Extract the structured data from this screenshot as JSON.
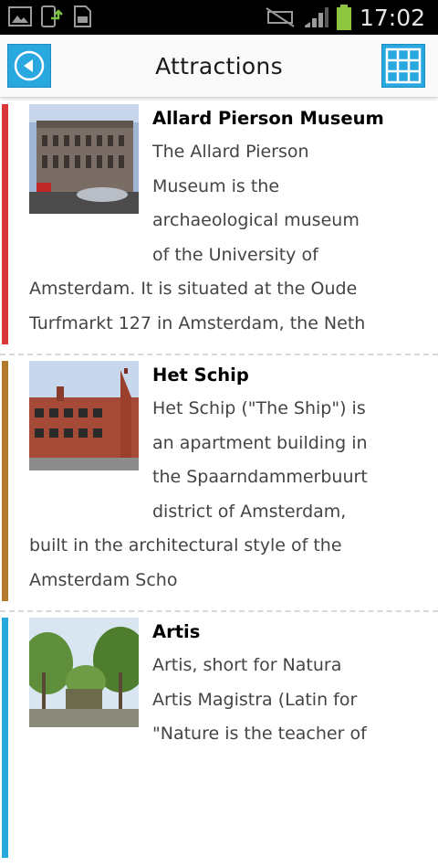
{
  "status_bar": {
    "time": "17:02"
  },
  "header": {
    "title": "Attractions",
    "back_icon": "back-arrow-icon",
    "grid_icon": "grid-icon"
  },
  "attractions": [
    {
      "name": "Allard Pierson Museum",
      "description": "The Allard Pierson Museum is the archaeological museum of the University of Amsterdam. It is situated at the Oude Turfmarkt 127 in Amsterdam, the Neth",
      "accent": "#d8383a"
    },
    {
      "name": "Het Schip",
      "description": "Het Schip (\"The Ship\") is an apartment building in the Spaarndammerbuurt district of Amsterdam, built in the architectural style of the Amsterdam Scho",
      "accent": "#b5792b"
    },
    {
      "name": "Artis",
      "description": "Artis, short for Natura Artis Magistra (Latin for \"Nature is the teacher of",
      "accent": "#29a8e0"
    }
  ]
}
